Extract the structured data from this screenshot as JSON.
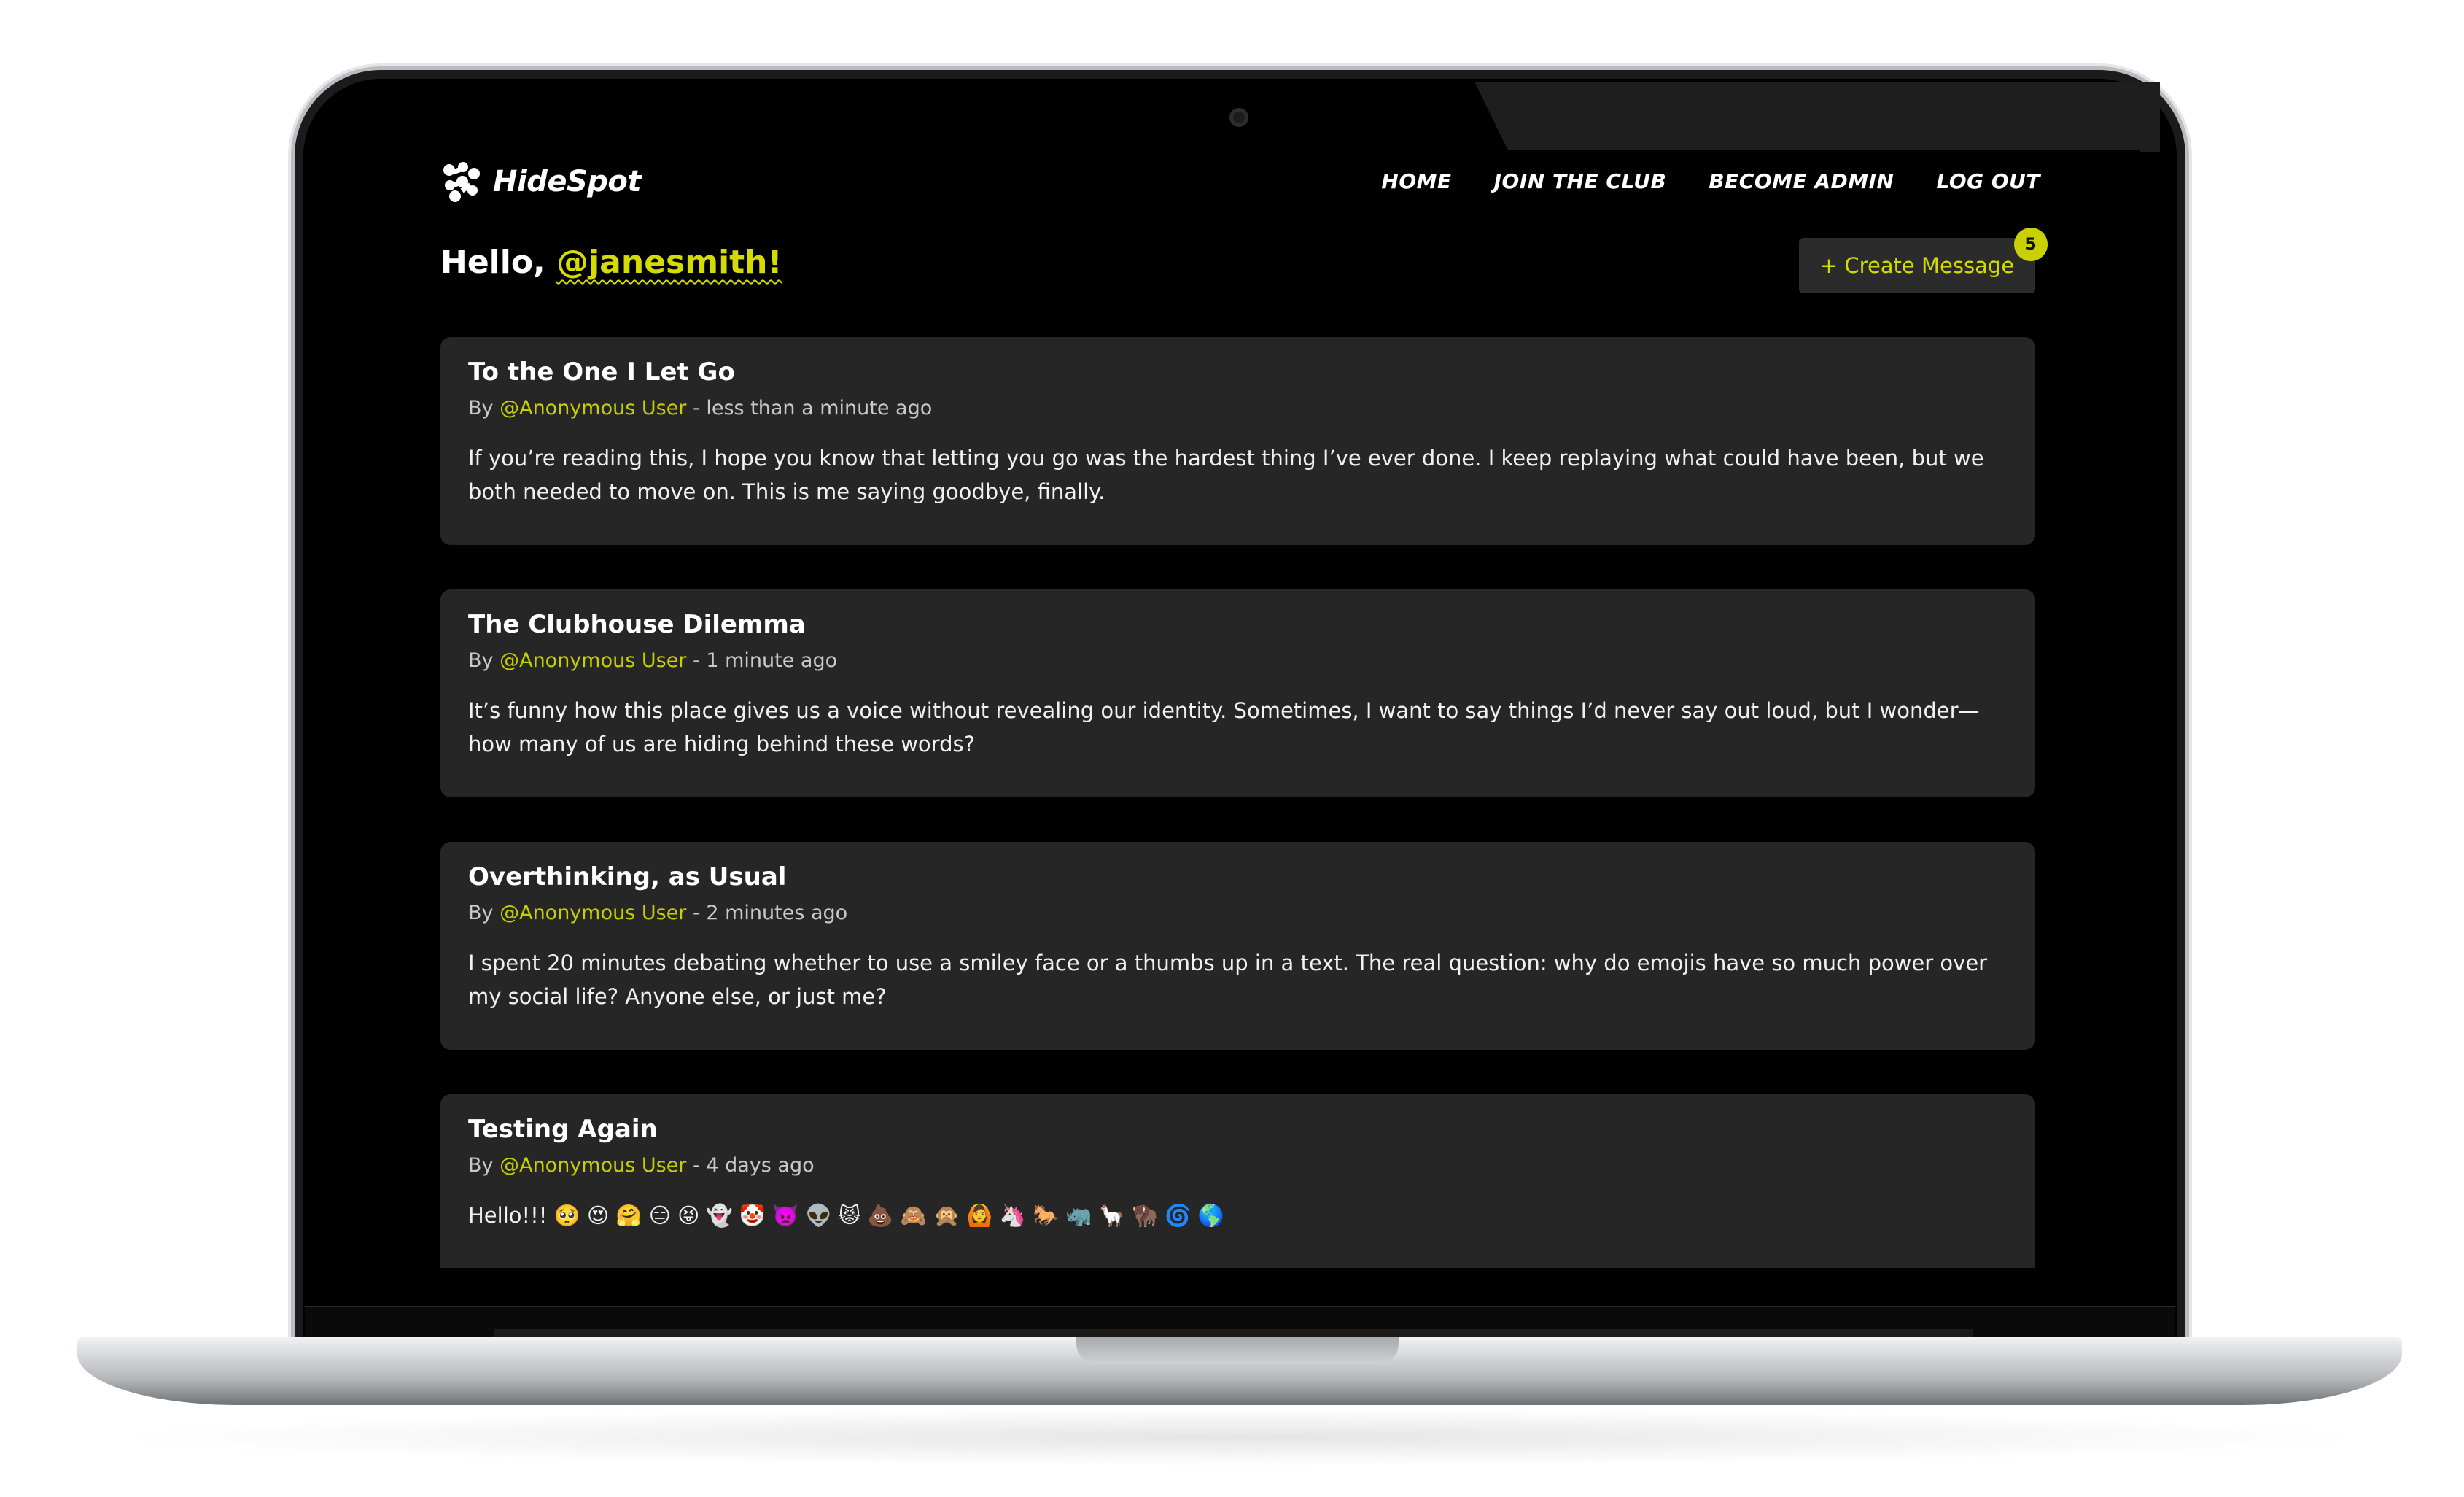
{
  "brand": {
    "name": "HideSpot",
    "logo_icon": "puzzle-logo-icon"
  },
  "nav": {
    "links": [
      {
        "label": "HOME"
      },
      {
        "label": "JOIN THE CLUB"
      },
      {
        "label": "BECOME ADMIN"
      },
      {
        "label": "LOG OUT"
      }
    ]
  },
  "greeting": {
    "prefix": "Hello, ",
    "username": "@janesmith!"
  },
  "create_button": {
    "label": "+ Create Message",
    "badge_count": "5"
  },
  "messages": [
    {
      "title": "To the One I Let Go",
      "by": "By ",
      "author": "@Anonymous User",
      "time": " - less than a minute ago",
      "body": "If you’re reading this, I hope you know that letting you go was the hardest thing I’ve ever done. I keep replaying what could have been, but we both needed to move on. This is me saying goodbye, finally."
    },
    {
      "title": "The Clubhouse Dilemma",
      "by": "By ",
      "author": "@Anonymous User",
      "time": " - 1 minute ago",
      "body": "It’s funny how this place gives us a voice without revealing our identity. Sometimes, I want to say things I’d never say out loud, but I wonder—how many of us are hiding behind these words?"
    },
    {
      "title": "Overthinking, as Usual",
      "by": "By ",
      "author": "@Anonymous User",
      "time": " - 2 minutes ago",
      "body": "I spent 20 minutes debating whether to use a smiley face or a thumbs up in a text. The real question: why do emojis have so much power over my social life? Anyone else, or just me?"
    },
    {
      "title": "Testing Again",
      "by": "By ",
      "author": "@Anonymous User",
      "time": " - 4 days ago",
      "body": "Hello!!! 🥺 😍 🤗 😑 😝 👻 🤡 👿 👽 😾 💩 🙈 🙊 🙆 🦄 🐎 🦏 🦙 🦬 🌀 🌎"
    }
  ],
  "colors": {
    "accent": "#d4db00",
    "card_bg": "#262626",
    "page_bg": "#000000"
  }
}
